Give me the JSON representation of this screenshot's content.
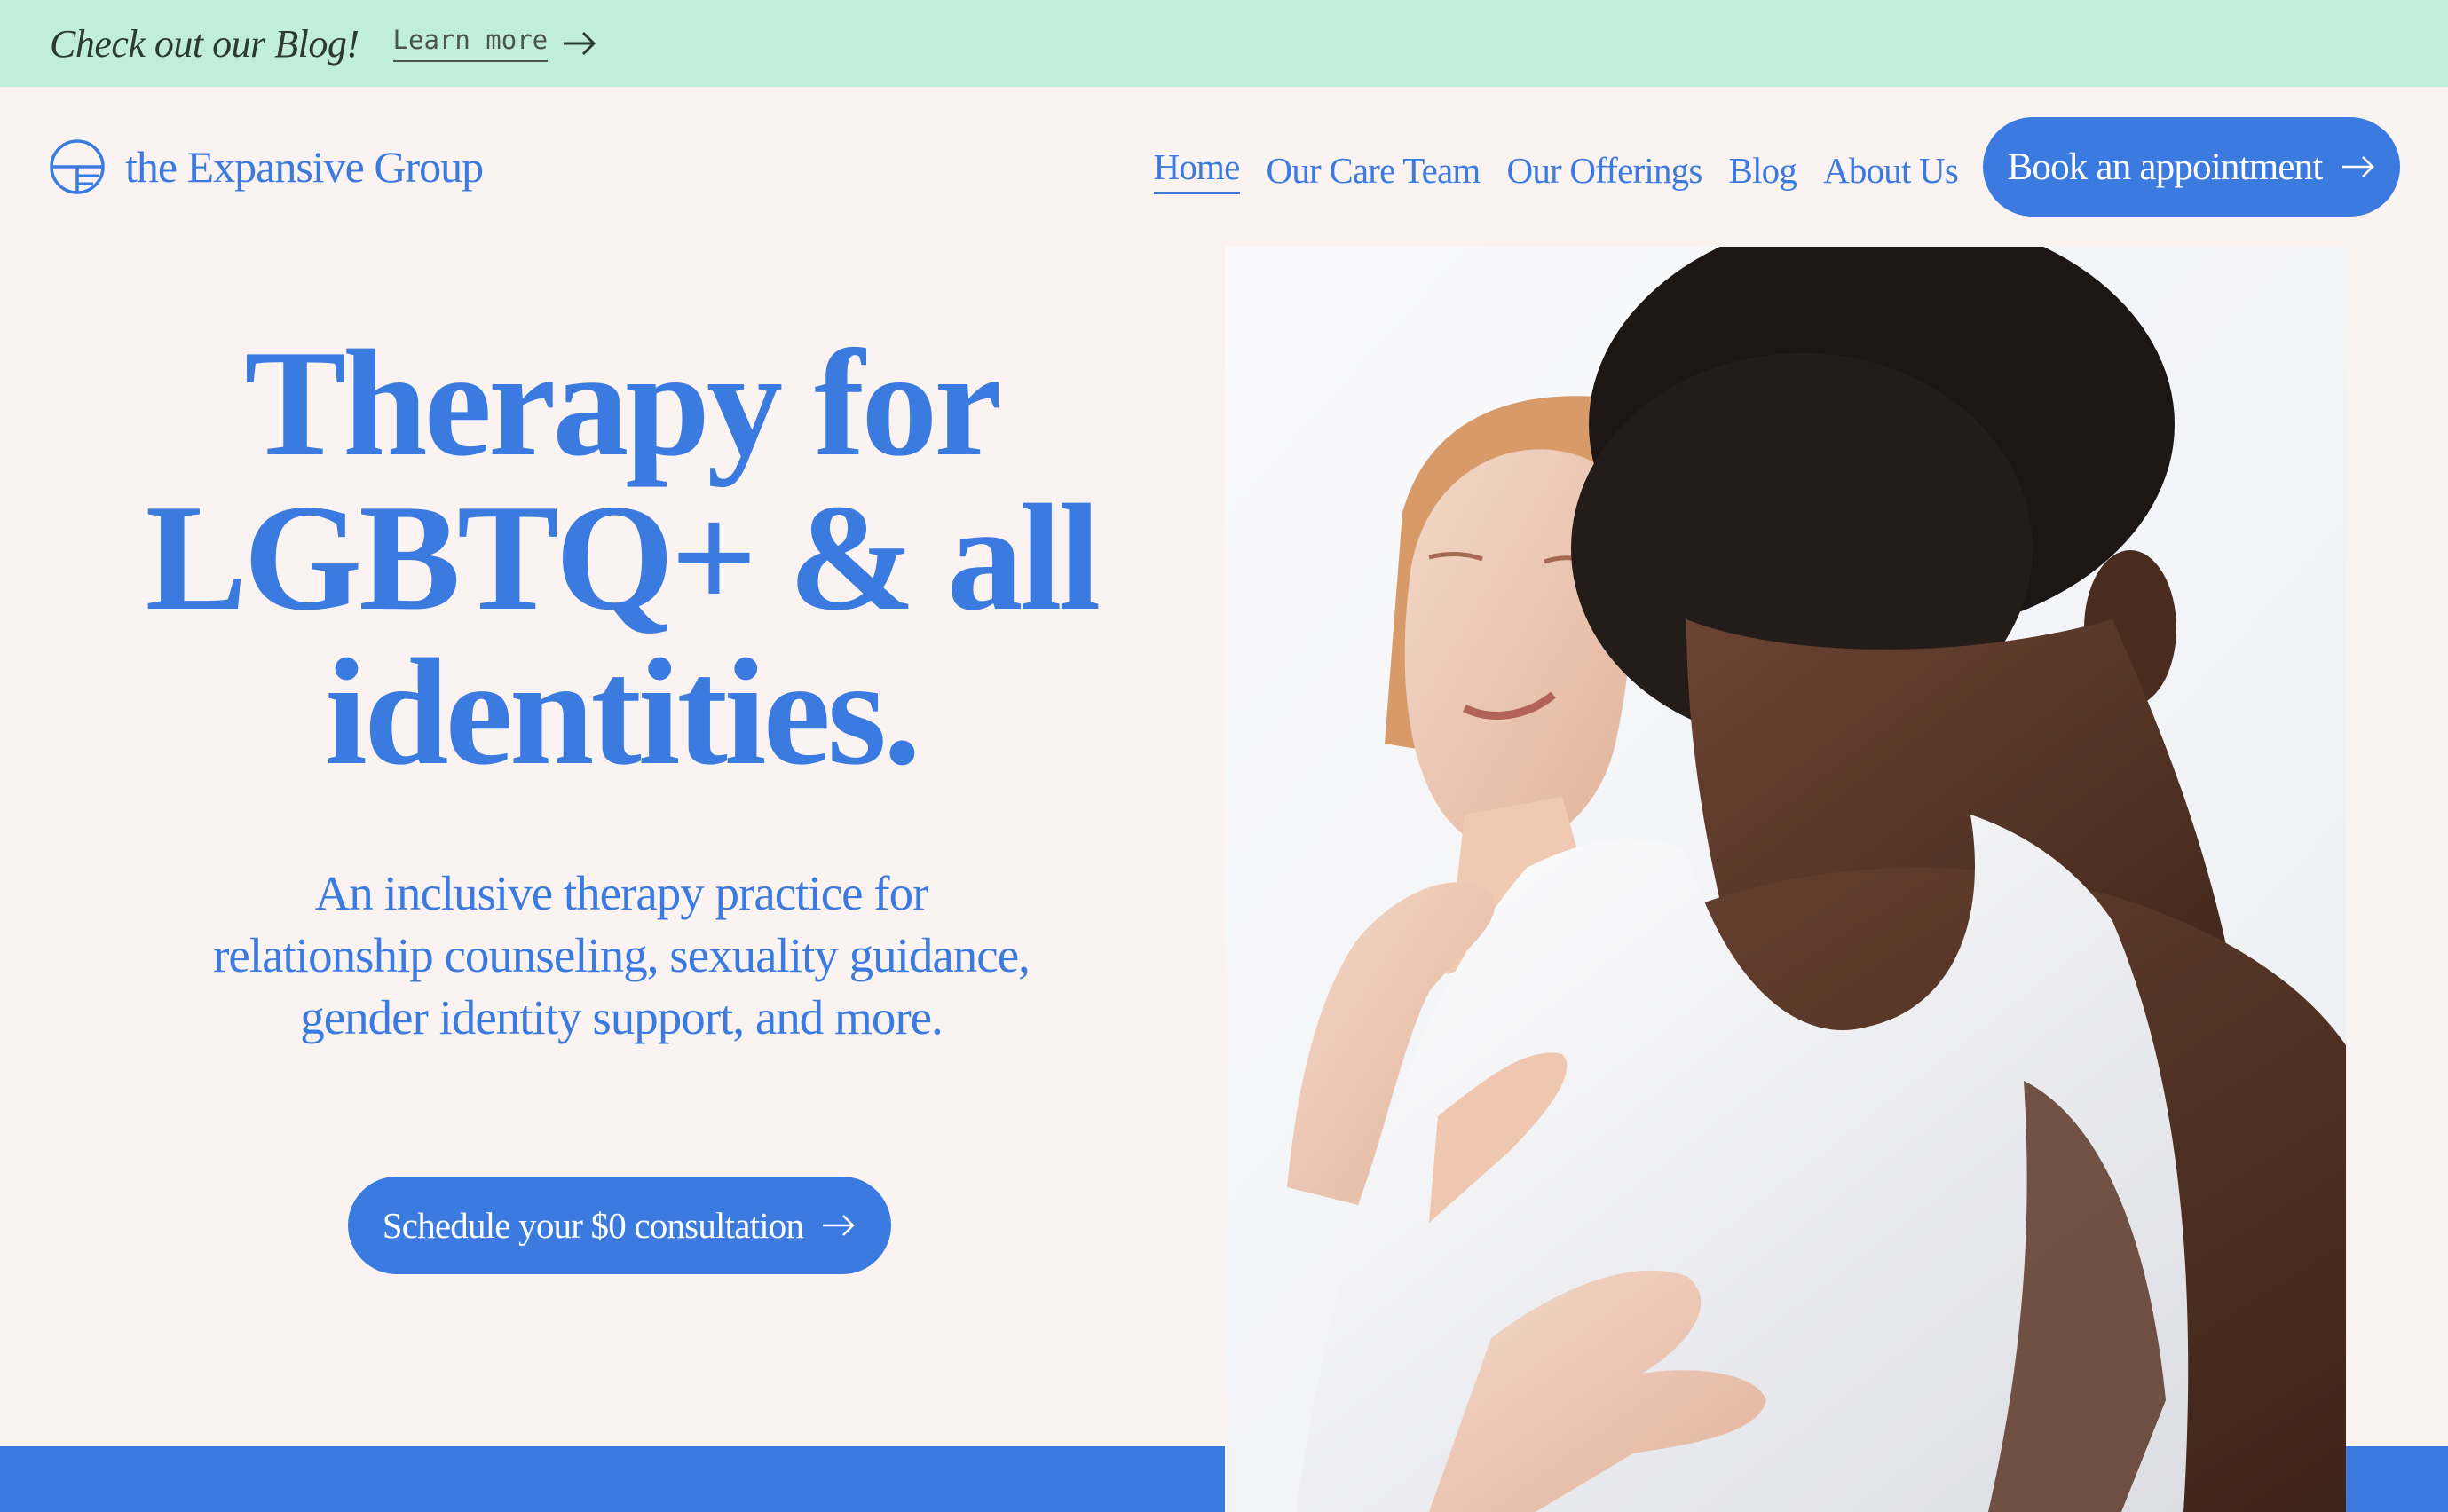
{
  "announcement": {
    "text": "Check out our Blog!",
    "link_label": "Learn more"
  },
  "brand": {
    "name": "the Expansive Group"
  },
  "nav": {
    "items": [
      {
        "label": "Home",
        "active": true
      },
      {
        "label": "Our Care Team"
      },
      {
        "label": "Our Offerings"
      },
      {
        "label": "Blog"
      },
      {
        "label": "About Us"
      }
    ],
    "cta_label": "Book an appointment"
  },
  "hero": {
    "title_lines": [
      "Therapy for",
      "LGBTQ+ & all",
      "identities."
    ],
    "subtitle": "An inclusive therapy practice for relationship counseling, sexuality guidance, gender identity support, and more.",
    "cta_label": "Schedule your $0 consultation"
  },
  "icons": [
    "logo-icon",
    "arrow-right-icon"
  ],
  "colors": {
    "accent": "#3b7be0",
    "announcement_bg": "#c1eedb",
    "page_bg": "#fbf3f2",
    "button_text": "#ffffff"
  }
}
